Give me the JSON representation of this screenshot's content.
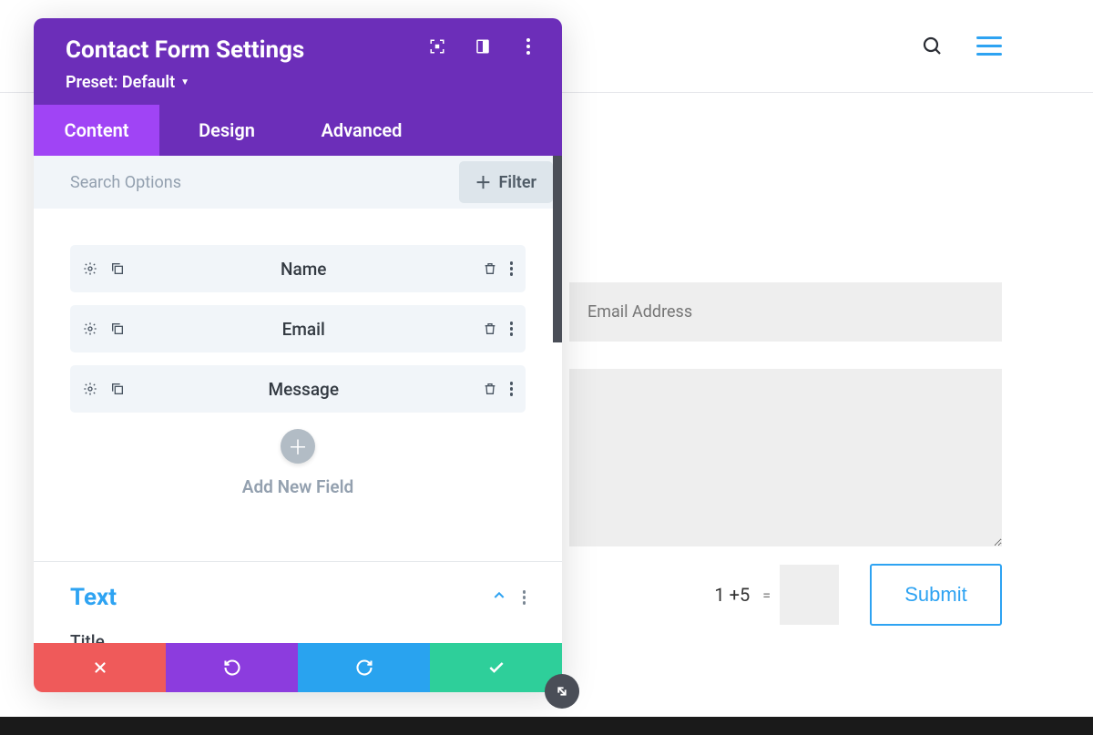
{
  "header": {
    "title": "Contact Form Settings",
    "preset": "Preset: Default"
  },
  "tabs": {
    "content": "Content",
    "design": "Design",
    "advanced": "Advanced"
  },
  "search": {
    "placeholder": "Search Options",
    "filter_label": "Filter"
  },
  "fields": [
    {
      "label": "Name"
    },
    {
      "label": "Email"
    },
    {
      "label": "Message"
    }
  ],
  "add_new": "Add New Field",
  "text_section": {
    "heading": "Text",
    "title_label": "Title"
  },
  "preview": {
    "email_placeholder": "Email Address"
  },
  "captcha": {
    "question": "1 +5",
    "equals": "="
  },
  "submit_label": "Submit"
}
